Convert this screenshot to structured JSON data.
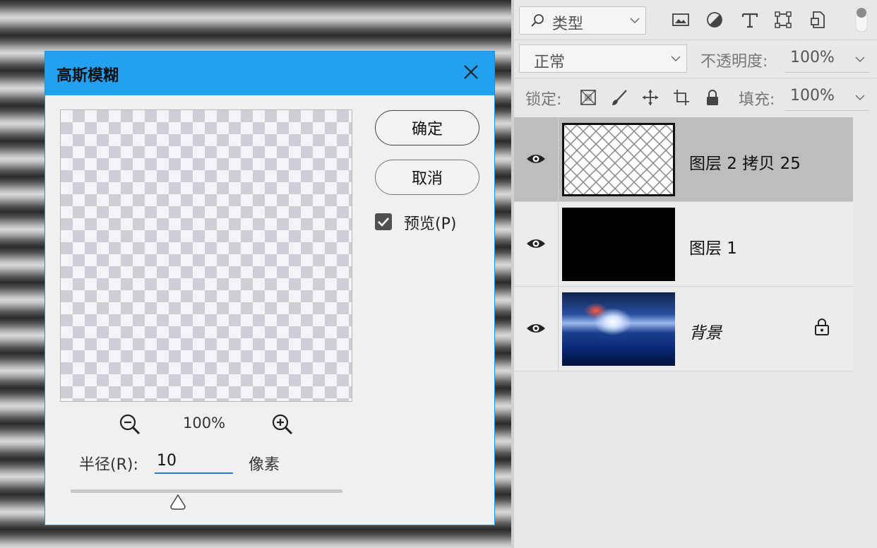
{
  "dialog": {
    "title": "高斯模糊",
    "ok_label": "确定",
    "cancel_label": "取消",
    "preview_label": "预览(P)",
    "preview_checked": true,
    "zoom_level": "100%",
    "radius_label": "半径(R):",
    "radius_value": "10",
    "radius_unit": "像素"
  },
  "layers_panel": {
    "filter_kind": "类型",
    "filter_icons": [
      "image-filter-icon",
      "adjustment-filter-icon",
      "type-filter-icon",
      "shape-filter-icon",
      "smart-object-filter-icon"
    ],
    "blend_mode": "正常",
    "opacity_label": "不透明度:",
    "opacity_value": "100%",
    "lock_label": "锁定:",
    "lock_icons": [
      "lock-transparent-icon",
      "lock-paint-icon",
      "lock-move-icon",
      "lock-artboard-icon",
      "lock-all-icon"
    ],
    "fill_label": "填充:",
    "fill_value": "100%",
    "layers": [
      {
        "name": "图层 2 拷贝 25",
        "visible": true,
        "selected": true
      },
      {
        "name": "图层 1",
        "visible": true,
        "selected": false
      },
      {
        "name": "背景",
        "visible": true,
        "selected": false,
        "locked": true
      }
    ]
  },
  "colors": {
    "dialog_title_bar": "#23a0f0",
    "input_underline": "#2b7bd0",
    "selected_layer": "#bdbdbd"
  }
}
